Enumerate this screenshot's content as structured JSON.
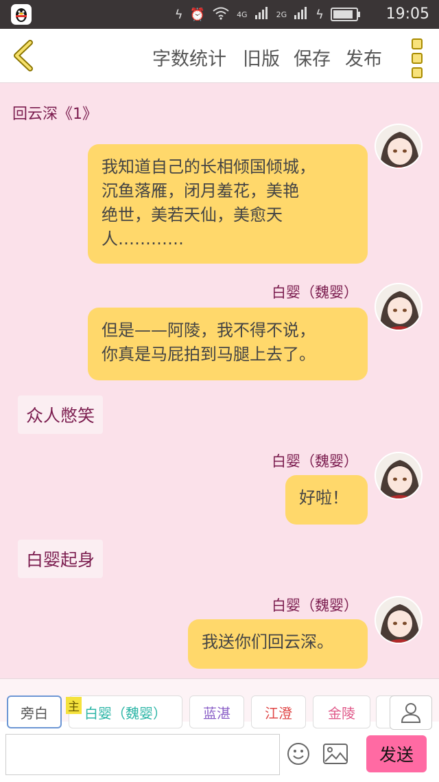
{
  "status_bar": {
    "app_icon": "qq-penguin-icon",
    "network_labels": [
      "4G",
      "2G"
    ],
    "time": "19:05"
  },
  "toolbar": {
    "back_icon": "chevron-left-icon",
    "word_count_label": "字数统计",
    "old_version_label": "旧版",
    "save_label": "保存",
    "publish_label": "发布",
    "menu_icon": "more-vertical-icon"
  },
  "chat": {
    "chapter_title": "回云深《1》",
    "messages": [
      {
        "type": "dialogue",
        "speaker": "",
        "text_lines": [
          "我知道自己的长相倾国倾城，",
          "沉鱼落雁，闭月羞花，美艳",
          "绝世，美若天仙，美愈天",
          "人…………"
        ]
      },
      {
        "type": "dialogue",
        "speaker": "白婴（魏婴）",
        "text_lines": [
          "但是——阿陵，我不得不说，",
          "你真是马屁拍到马腿上去了。"
        ]
      },
      {
        "type": "narration",
        "text": "众人憋笑"
      },
      {
        "type": "dialogue",
        "speaker": "白婴（魏婴）",
        "text_lines": [
          "好啦！"
        ]
      },
      {
        "type": "narration",
        "text": "白婴起身"
      },
      {
        "type": "dialogue",
        "speaker": "白婴（魏婴）",
        "text_lines": [
          "我送你们回云深。"
        ]
      }
    ]
  },
  "roles": {
    "main_tag": "主",
    "items": [
      {
        "label": "旁白",
        "color": "#555555",
        "active": true
      },
      {
        "label": "白婴（魏婴）",
        "color": "#2bb5a6",
        "active": false
      },
      {
        "label": "蓝湛",
        "color": "#8a5fc7",
        "active": false
      },
      {
        "label": "江澄",
        "color": "#e04848",
        "active": false
      },
      {
        "label": "金陵",
        "color": "#e05a8a",
        "active": false
      }
    ],
    "user_icon": "person-icon"
  },
  "composer": {
    "input_value": "",
    "emoji_icon": "smiley-icon",
    "image_icon": "image-icon",
    "send_label": "发送"
  },
  "colors": {
    "background": "#fbe1ea",
    "bubble": "#ffd86b",
    "accent_text": "#7b1d4f",
    "send_button": "#ff6aa3"
  }
}
